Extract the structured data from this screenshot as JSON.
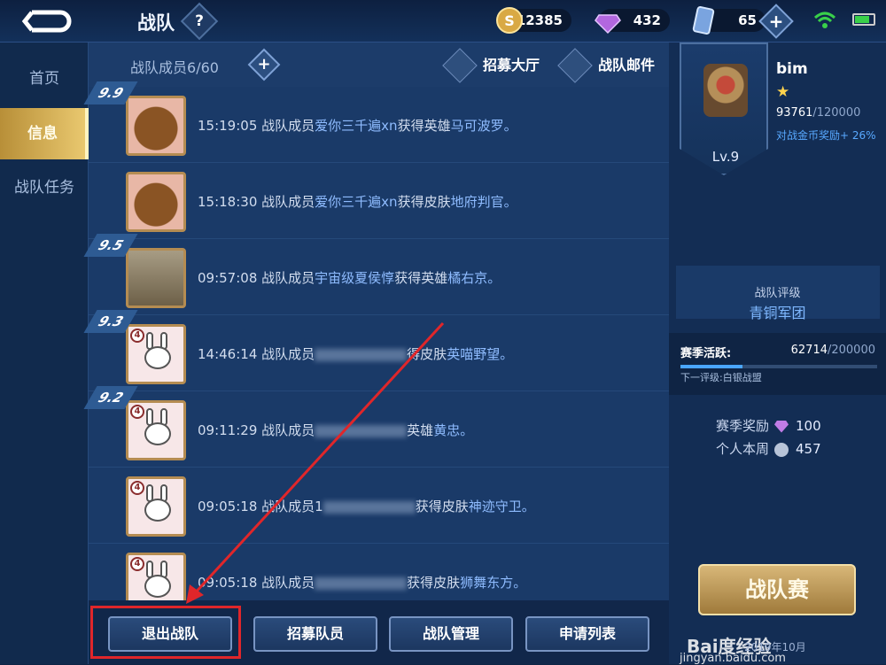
{
  "topbar": {
    "title": "战队",
    "help_icon": "?",
    "coins": "12385",
    "gems": "432",
    "vouchers": "65"
  },
  "nav": {
    "items": [
      "首页",
      "信息",
      "战队任务"
    ],
    "active": "信息"
  },
  "list": {
    "members_label": "战队成员",
    "members_count": "6/60",
    "recruit_hall": "招募大厅",
    "team_mail": "战队邮件",
    "rows": [
      {
        "date": "9.9",
        "time": "15:19:05",
        "prefix": "战队成员",
        "name": "爱你三千遍xn",
        "action": "获得英雄",
        "item": "马可波罗。",
        "avatar": "bear"
      },
      {
        "date": "",
        "time": "15:18:30",
        "prefix": "战队成员",
        "name": "爱你三千遍xn",
        "action": "获得皮肤",
        "item": "地府判官。",
        "avatar": "bear"
      },
      {
        "date": "9.5",
        "time": "09:57:08",
        "prefix": "战队成员",
        "name": "宇宙级夏侯惇",
        "action": "获得英雄",
        "item": "橘右京。",
        "avatar": "statue"
      },
      {
        "date": "9.3",
        "time": "14:46:14",
        "prefix": "战队成员",
        "name": "",
        "action": "得皮肤",
        "item": "英喵野望。",
        "avatar": "bunny"
      },
      {
        "date": "9.2",
        "time": "09:11:29",
        "prefix": "战队成员",
        "name": "",
        "action": "英雄",
        "item": "黄忠。",
        "avatar": "bunny"
      },
      {
        "date": "",
        "time": "09:05:18",
        "prefix": "战队成员1",
        "name": "",
        "action": "获得皮肤",
        "item": "神迹守卫。",
        "avatar": "bunny"
      },
      {
        "date": "",
        "time": "09:05:18",
        "prefix": "战队成员",
        "name": "",
        "action": "获得皮肤",
        "item": "狮舞东方。",
        "avatar": "bunny"
      }
    ]
  },
  "actions": [
    "退出战队",
    "招募队员",
    "战队管理",
    "申请列表"
  ],
  "profile": {
    "name": "bim",
    "level": "Lv.9",
    "xp": "93761",
    "xp_max": "/120000",
    "bonus": "对战金币奖励+ 26%"
  },
  "rating": {
    "label": "战队评级",
    "value": "青铜军团"
  },
  "season": {
    "label": "赛季活跃:",
    "value": "62714",
    "max": "/200000",
    "progress": 0.314,
    "next": "下一评级:白银战盟"
  },
  "rewards": {
    "season_label": "赛季奖励",
    "season_value": "100",
    "weekly_label": "个人本周",
    "weekly_value": "457"
  },
  "war_button": "战队赛",
  "watermark": {
    "brand": "Bai度经验",
    "url": "jingyan.baidu.com",
    "date": "2019年10月"
  },
  "colors": {
    "accent_gold": "#e9c86f",
    "highlight_red": "#e0262a",
    "link_blue": "#8fbcff"
  }
}
